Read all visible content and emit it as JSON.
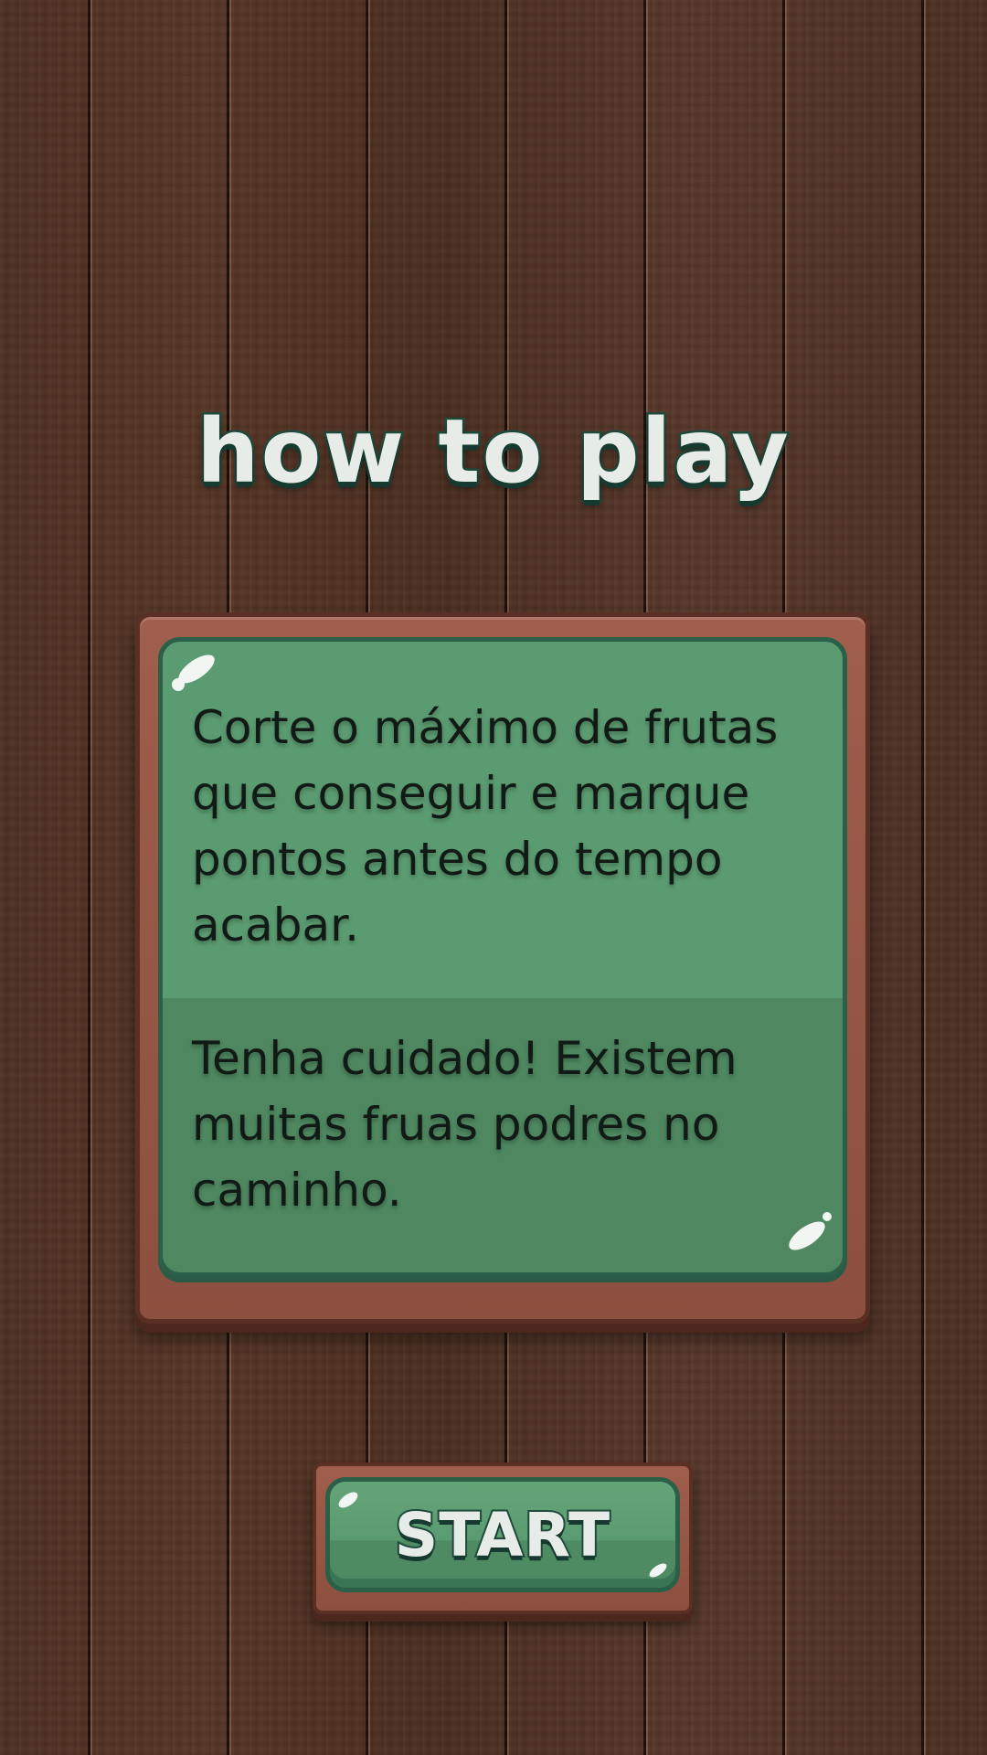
{
  "screen": {
    "title": "how to play"
  },
  "panel": {
    "instruction_1": "Corte o máximo de frutas que conseguir e marque pontos antes do tempo acabar.",
    "instruction_2": "Tenha cuidado! Existem muitas fruas podres no caminho."
  },
  "start_button": {
    "label": "START"
  },
  "colors": {
    "wood_background": "#4a2e20",
    "panel_green": "#5b9b71",
    "panel_green_dark": "#4e8760",
    "frame_brown": "#8d4f3f",
    "outline_green": "#1f4a3c",
    "title_fill": "#e8ece9"
  }
}
